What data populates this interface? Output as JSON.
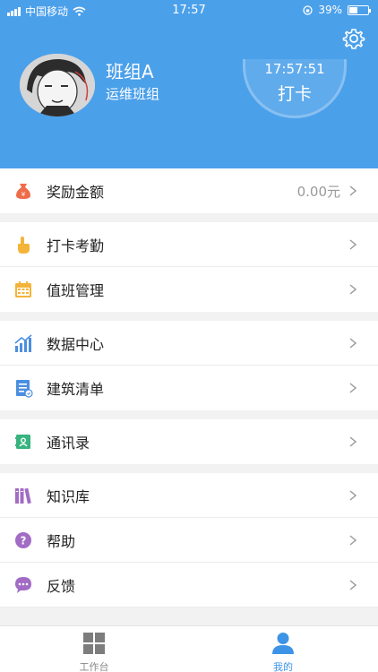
{
  "status_bar": {
    "carrier": "中国移动",
    "time": "17:57",
    "battery": "39%",
    "battery_level": 0.39
  },
  "profile": {
    "name": "班组A",
    "team": "运维班组"
  },
  "clock_in": {
    "time": "17:57:51",
    "label": "打卡"
  },
  "menu": {
    "reward": {
      "label": "奖励金额",
      "value": "0.00元"
    },
    "attendance": {
      "label": "打卡考勤"
    },
    "duty": {
      "label": "值班管理"
    },
    "data_center": {
      "label": "数据中心"
    },
    "building_list": {
      "label": "建筑清单"
    },
    "contacts": {
      "label": "通讯录"
    },
    "knowledge": {
      "label": "知识库"
    },
    "help": {
      "label": "帮助"
    },
    "feedback": {
      "label": "反馈"
    }
  },
  "tabbar": {
    "workbench": {
      "label": "工作台"
    },
    "mine": {
      "label": "我的"
    }
  },
  "colors": {
    "header": "#4ba0ea",
    "active_tab": "#3d94e6",
    "inactive_tab": "#888888"
  },
  "icons": [
    "settings-gear-icon",
    "money-bag-icon",
    "hand-pointer-icon",
    "calendar-icon",
    "bar-chart-icon",
    "document-list-icon",
    "contacts-book-icon",
    "books-icon",
    "question-icon",
    "chat-bubble-icon",
    "grid-icon",
    "person-icon"
  ]
}
